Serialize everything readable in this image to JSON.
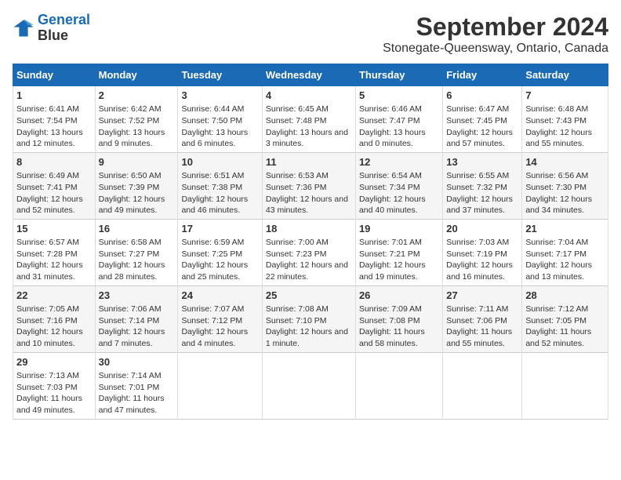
{
  "logo": {
    "line1": "General",
    "line2": "Blue"
  },
  "title": "September 2024",
  "subtitle": "Stonegate-Queensway, Ontario, Canada",
  "days_of_week": [
    "Sunday",
    "Monday",
    "Tuesday",
    "Wednesday",
    "Thursday",
    "Friday",
    "Saturday"
  ],
  "weeks": [
    [
      {
        "day": "1",
        "sunrise": "6:41 AM",
        "sunset": "7:54 PM",
        "daylight": "13 hours and 12 minutes."
      },
      {
        "day": "2",
        "sunrise": "6:42 AM",
        "sunset": "7:52 PM",
        "daylight": "13 hours and 9 minutes."
      },
      {
        "day": "3",
        "sunrise": "6:44 AM",
        "sunset": "7:50 PM",
        "daylight": "13 hours and 6 minutes."
      },
      {
        "day": "4",
        "sunrise": "6:45 AM",
        "sunset": "7:48 PM",
        "daylight": "13 hours and 3 minutes."
      },
      {
        "day": "5",
        "sunrise": "6:46 AM",
        "sunset": "7:47 PM",
        "daylight": "13 hours and 0 minutes."
      },
      {
        "day": "6",
        "sunrise": "6:47 AM",
        "sunset": "7:45 PM",
        "daylight": "12 hours and 57 minutes."
      },
      {
        "day": "7",
        "sunrise": "6:48 AM",
        "sunset": "7:43 PM",
        "daylight": "12 hours and 55 minutes."
      }
    ],
    [
      {
        "day": "8",
        "sunrise": "6:49 AM",
        "sunset": "7:41 PM",
        "daylight": "12 hours and 52 minutes."
      },
      {
        "day": "9",
        "sunrise": "6:50 AM",
        "sunset": "7:39 PM",
        "daylight": "12 hours and 49 minutes."
      },
      {
        "day": "10",
        "sunrise": "6:51 AM",
        "sunset": "7:38 PM",
        "daylight": "12 hours and 46 minutes."
      },
      {
        "day": "11",
        "sunrise": "6:53 AM",
        "sunset": "7:36 PM",
        "daylight": "12 hours and 43 minutes."
      },
      {
        "day": "12",
        "sunrise": "6:54 AM",
        "sunset": "7:34 PM",
        "daylight": "12 hours and 40 minutes."
      },
      {
        "day": "13",
        "sunrise": "6:55 AM",
        "sunset": "7:32 PM",
        "daylight": "12 hours and 37 minutes."
      },
      {
        "day": "14",
        "sunrise": "6:56 AM",
        "sunset": "7:30 PM",
        "daylight": "12 hours and 34 minutes."
      }
    ],
    [
      {
        "day": "15",
        "sunrise": "6:57 AM",
        "sunset": "7:28 PM",
        "daylight": "12 hours and 31 minutes."
      },
      {
        "day": "16",
        "sunrise": "6:58 AM",
        "sunset": "7:27 PM",
        "daylight": "12 hours and 28 minutes."
      },
      {
        "day": "17",
        "sunrise": "6:59 AM",
        "sunset": "7:25 PM",
        "daylight": "12 hours and 25 minutes."
      },
      {
        "day": "18",
        "sunrise": "7:00 AM",
        "sunset": "7:23 PM",
        "daylight": "12 hours and 22 minutes."
      },
      {
        "day": "19",
        "sunrise": "7:01 AM",
        "sunset": "7:21 PM",
        "daylight": "12 hours and 19 minutes."
      },
      {
        "day": "20",
        "sunrise": "7:03 AM",
        "sunset": "7:19 PM",
        "daylight": "12 hours and 16 minutes."
      },
      {
        "day": "21",
        "sunrise": "7:04 AM",
        "sunset": "7:17 PM",
        "daylight": "12 hours and 13 minutes."
      }
    ],
    [
      {
        "day": "22",
        "sunrise": "7:05 AM",
        "sunset": "7:16 PM",
        "daylight": "12 hours and 10 minutes."
      },
      {
        "day": "23",
        "sunrise": "7:06 AM",
        "sunset": "7:14 PM",
        "daylight": "12 hours and 7 minutes."
      },
      {
        "day": "24",
        "sunrise": "7:07 AM",
        "sunset": "7:12 PM",
        "daylight": "12 hours and 4 minutes."
      },
      {
        "day": "25",
        "sunrise": "7:08 AM",
        "sunset": "7:10 PM",
        "daylight": "12 hours and 1 minute."
      },
      {
        "day": "26",
        "sunrise": "7:09 AM",
        "sunset": "7:08 PM",
        "daylight": "11 hours and 58 minutes."
      },
      {
        "day": "27",
        "sunrise": "7:11 AM",
        "sunset": "7:06 PM",
        "daylight": "11 hours and 55 minutes."
      },
      {
        "day": "28",
        "sunrise": "7:12 AM",
        "sunset": "7:05 PM",
        "daylight": "11 hours and 52 minutes."
      }
    ],
    [
      {
        "day": "29",
        "sunrise": "7:13 AM",
        "sunset": "7:03 PM",
        "daylight": "11 hours and 49 minutes."
      },
      {
        "day": "30",
        "sunrise": "7:14 AM",
        "sunset": "7:01 PM",
        "daylight": "11 hours and 47 minutes."
      },
      null,
      null,
      null,
      null,
      null
    ]
  ]
}
